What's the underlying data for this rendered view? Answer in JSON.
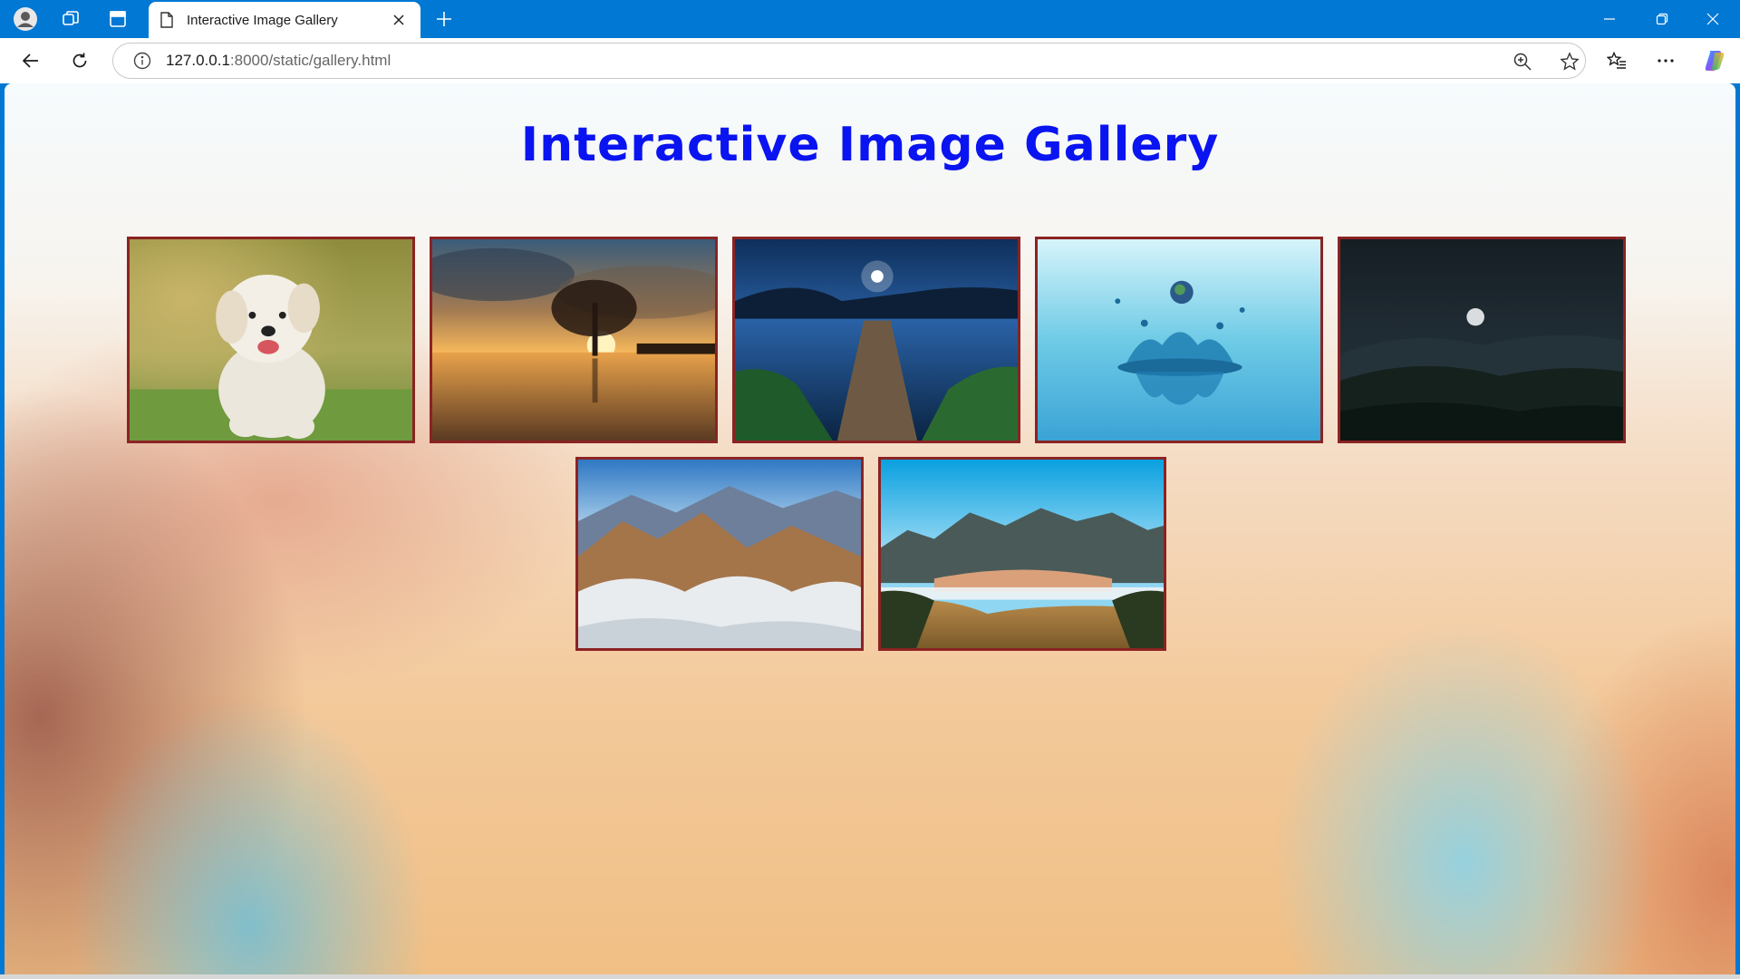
{
  "browser": {
    "tab_title": "Interactive Image Gallery",
    "url_host": "127.0.0.1",
    "url_path": ":8000/static/gallery.html"
  },
  "page": {
    "title": "Interactive Image Gallery"
  },
  "gallery": [
    {
      "subject": "puppy"
    },
    {
      "subject": "sunset-tree"
    },
    {
      "subject": "lake-pier-night"
    },
    {
      "subject": "water-splash"
    },
    {
      "subject": "moon-forest"
    },
    {
      "subject": "snowy-mountains"
    },
    {
      "subject": "mountain-range"
    }
  ],
  "icons": {
    "profile": "profile-icon",
    "workspaces": "workspaces-icon",
    "vertical_tabs": "vertical-tabs-icon",
    "page": "page-icon",
    "close": "close-icon",
    "new_tab": "plus-icon",
    "minimize": "minimize-icon",
    "restore": "restore-icon",
    "window_close": "window-close-icon",
    "back": "back-arrow-icon",
    "refresh": "refresh-icon",
    "info": "info-icon",
    "zoom": "zoom-icon",
    "favorite": "star-icon",
    "favorites": "favorites-icon",
    "more": "more-icon",
    "copilot": "copilot-icon"
  }
}
